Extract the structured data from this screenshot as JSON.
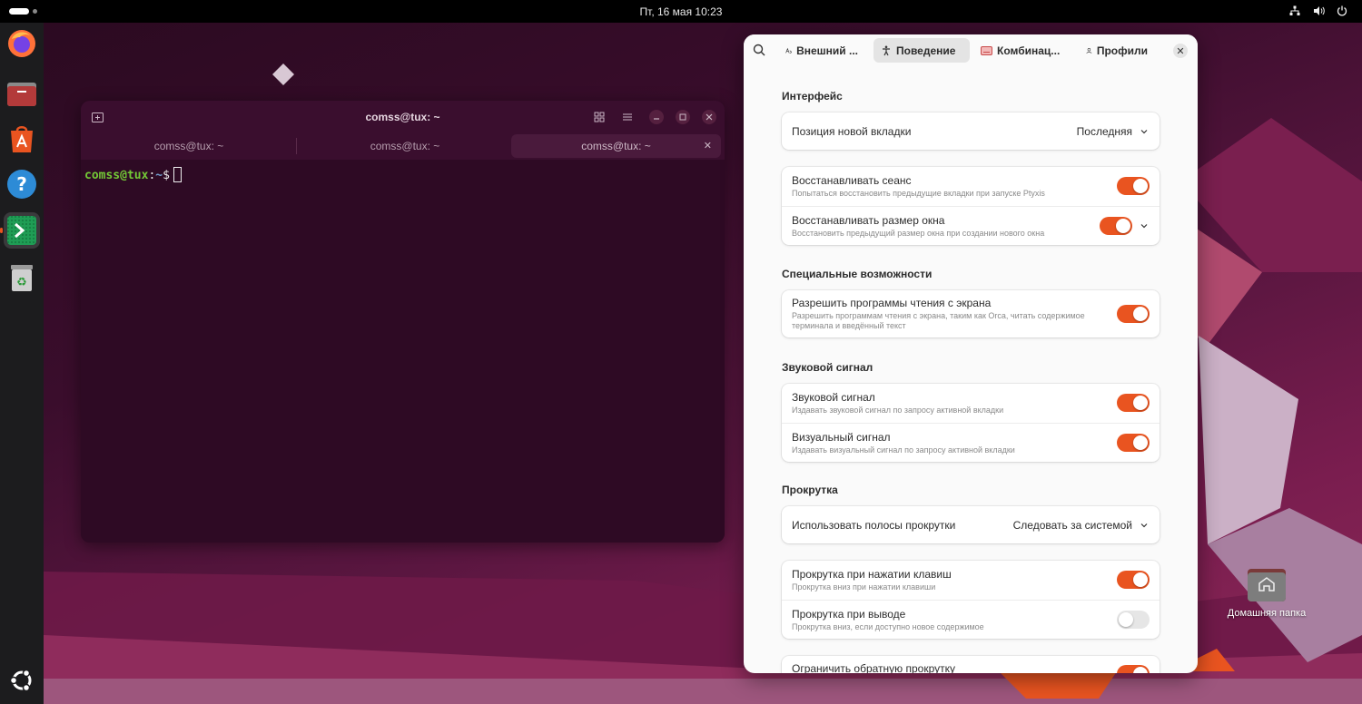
{
  "topbar": {
    "clock": "Пт, 16 мая  10:23",
    "tray_icons": [
      "network-icon",
      "volume-icon",
      "power-icon"
    ]
  },
  "dock": {
    "items": [
      {
        "name": "firefox",
        "icon": "firefox-icon"
      },
      {
        "name": "files",
        "icon": "files-icon"
      },
      {
        "name": "app-center",
        "icon": "app-center-icon"
      },
      {
        "name": "help",
        "icon": "help-icon"
      },
      {
        "name": "terminal",
        "icon": "terminal-icon",
        "active": true
      },
      {
        "name": "trash",
        "icon": "trash-icon"
      }
    ],
    "show_apps_icon": "ubuntu-logo-icon"
  },
  "terminal": {
    "title": "comss@tux: ~",
    "tabs": [
      {
        "label": "comss@tux: ~",
        "active": false
      },
      {
        "label": "comss@tux: ~",
        "active": false
      },
      {
        "label": "comss@tux: ~",
        "active": true
      }
    ],
    "prompt_user": "comss@tux",
    "prompt_sep": ":",
    "prompt_path": "~",
    "prompt_symbol": "$"
  },
  "prefs": {
    "tabs": [
      {
        "label": "Внешний ...",
        "icon": "appearance-icon",
        "active": false
      },
      {
        "label": "Поведение",
        "icon": "accessibility-icon",
        "active": true
      },
      {
        "label": "Комбинац...",
        "icon": "keyboard-icon",
        "active": false
      },
      {
        "label": "Профили",
        "icon": "profile-icon",
        "active": false
      }
    ],
    "sections": {
      "interface": {
        "title": "Интерфейс",
        "tab_position": {
          "label": "Позиция новой вкладки",
          "value": "Последняя"
        },
        "restore_session": {
          "label": "Восстанавливать сеанс",
          "sub": "Попытаться восстановить предыдущие вкладки при запуске Ptyxis",
          "on": true
        },
        "restore_window_size": {
          "label": "Восстанавливать размер окна",
          "sub": "Восстановить предыдущий размер окна при создании нового окна",
          "on": true
        }
      },
      "accessibility": {
        "title": "Специальные возможности",
        "screen_readers": {
          "label": "Разрешить программы чтения с экрана",
          "sub": "Разрешить программам чтения с экрана, таким как Orca, читать содержимое терминала и введённый текст",
          "on": true
        }
      },
      "bell": {
        "title": "Звуковой сигнал",
        "audible": {
          "label": "Звуковой сигнал",
          "sub": "Издавать звуковой сигнал по запросу активной вкладки",
          "on": true
        },
        "visual": {
          "label": "Визуальный сигнал",
          "sub": "Издавать визуальный сигнал по запросу активной вкладки",
          "on": true
        }
      },
      "scrolling": {
        "title": "Прокрутка",
        "scrollbars": {
          "label": "Использовать полосы прокрутки",
          "value": "Следовать за системой"
        },
        "scroll_on_keystroke": {
          "label": "Прокрутка при нажатии клавиш",
          "sub": "Прокрутка вниз при нажатии клавиши",
          "on": true
        },
        "scroll_on_output": {
          "label": "Прокрутка при выводе",
          "sub": "Прокрутка вниз, если доступно новое содержимое",
          "on": false
        },
        "limit_scrollback": {
          "label": "Ограничить обратную прокрутку",
          "on": true
        }
      }
    }
  },
  "desktop": {
    "home_folder_label": "Домашняя папка"
  },
  "colors": {
    "accent": "#e95420",
    "terminal_bg": "#2e0a24",
    "prompt_user": "#73c936",
    "prompt_path": "#729fcf"
  }
}
